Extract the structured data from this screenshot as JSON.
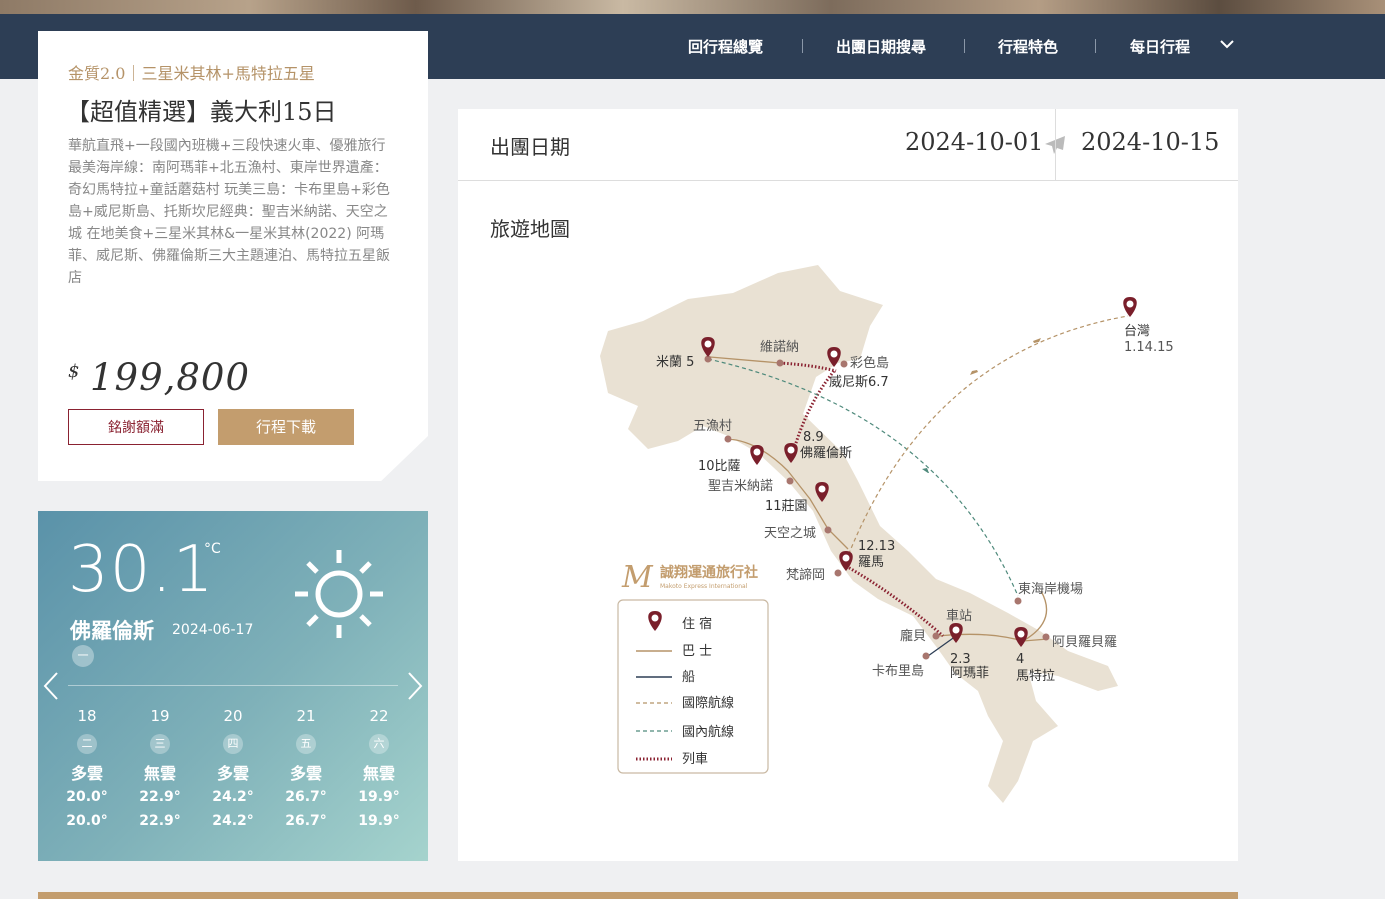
{
  "nav": {
    "items": [
      "回行程總覽",
      "出團日期搜尋",
      "行程特色",
      "每日行程"
    ]
  },
  "tour": {
    "subtitle": "金質2.0｜三星米其林+馬特拉五星",
    "title": "【超值精選】義大利15日",
    "description": "華航直飛+一段國內班機+三段快速火車、優雅旅行 最美海岸線：南阿瑪菲+北五漁村、東岸世界遺產：奇幻馬特拉+童話蘑菇村 玩美三島：卡布里島+彩色島+威尼斯島、托斯坎尼經典：聖吉米納諾、天空之城 在地美食+三星米其林&一星米其林(2022) 阿瑪菲、威尼斯、佛羅倫斯三大主題連泊、馬特拉五星飯店",
    "currency": "$",
    "price": "199,800",
    "sold_out_label": "銘謝額滿",
    "download_label": "行程下載"
  },
  "weather": {
    "temp": "30.1",
    "unit": "°C",
    "city": "佛羅倫斯",
    "date": "2024-06-17",
    "weekday": "一",
    "forecast": [
      {
        "day": "18",
        "weekday": "二",
        "cond": "多雲",
        "hi": "20.0°",
        "lo": "20.0°"
      },
      {
        "day": "19",
        "weekday": "三",
        "cond": "無雲",
        "hi": "22.9°",
        "lo": "22.9°"
      },
      {
        "day": "20",
        "weekday": "四",
        "cond": "多雲",
        "hi": "24.2°",
        "lo": "24.2°"
      },
      {
        "day": "21",
        "weekday": "五",
        "cond": "多雲",
        "hi": "26.7°",
        "lo": "26.7°"
      },
      {
        "day": "22",
        "weekday": "六",
        "cond": "無雲",
        "hi": "19.9°",
        "lo": "19.9°"
      }
    ]
  },
  "departure": {
    "label": "出團日期",
    "from": "2024-10-01",
    "to": "2024-10-15"
  },
  "map": {
    "label": "旅遊地圖",
    "places": {
      "milan": "米蘭 5",
      "verona": "維諾納",
      "burano": "彩色島",
      "venice": "威尼斯6.7",
      "cinque_terre": "五漁村",
      "florence_n": "8.9",
      "florence": "佛羅倫斯",
      "pisa": "10比薩",
      "san_gimignano": "聖吉米納諾",
      "farm": "11莊園",
      "civita": "天空之城",
      "rome_n": "12.13",
      "rome": "羅馬",
      "vatican": "梵諦岡",
      "station": "車站",
      "ravello": "龐貝",
      "capri": "卡布里島",
      "amalfi_n": "2.3",
      "amalfi": "阿瑪菲",
      "matera_n": "4",
      "matera": "馬特拉",
      "alberobello": "阿貝羅貝羅",
      "east_airport": "東海岸機場",
      "taiwan": "台灣",
      "taiwan_n": "1.14.15"
    },
    "company": {
      "name": "誠翔運通旅行社",
      "en": "Makoto Express International"
    },
    "legend": [
      "住 宿",
      "巴 士",
      "船",
      "國際航線",
      "國內航線",
      "列車"
    ],
    "colors": {
      "accent": "#7a1f2b",
      "bus": "#b59368",
      "boat": "#2d3e55",
      "intl": "#b59368",
      "domestic": "#4f8a7c",
      "train": "#8a2231",
      "land": "#e9e1d3"
    }
  }
}
